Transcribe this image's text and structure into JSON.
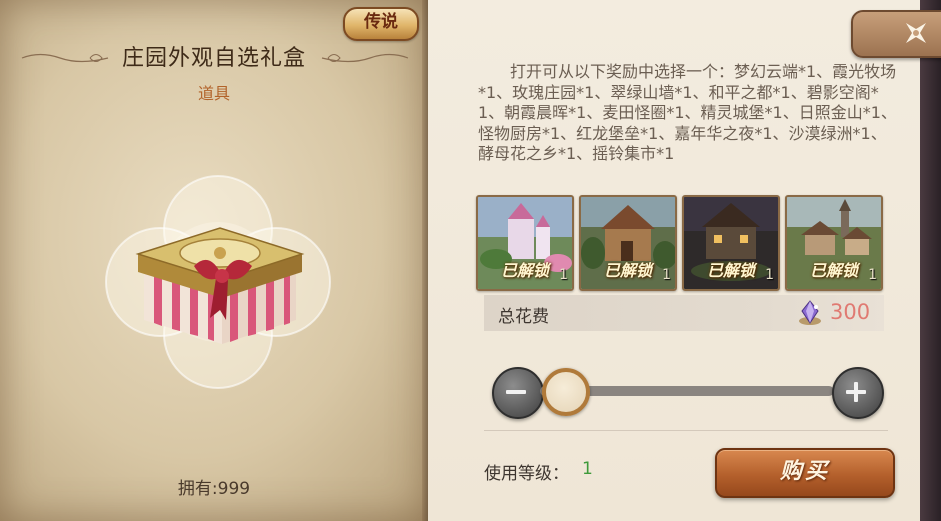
{
  "item": {
    "rarity": "传说",
    "title": "庄园外观自选礼盒",
    "type": "道具",
    "owned": "拥有:999"
  },
  "reward": {
    "description": "打开可从以下奖励中选择一个：梦幻云端*1、霞光牧场*1、玫瑰庄园*1、翠绿山墙*1、和平之都*1、碧影空阁*1、朝霞晨晖*1、麦田怪圈*1、精灵城堡*1、日照金山*1、怪物厨房*1、红龙堡垒*1、嘉年华之夜*1、沙漠绿洲*1、酵母花之乡*1、摇铃集市*1",
    "thumbnails": [
      {
        "label": "已解锁",
        "qty": "1",
        "icon": "pink-castle-scene"
      },
      {
        "label": "已解锁",
        "qty": "1",
        "icon": "wooden-house-scene"
      },
      {
        "label": "已解锁",
        "qty": "1",
        "icon": "night-manor-scene"
      },
      {
        "label": "已解锁",
        "qty": "1",
        "icon": "hillside-village-scene"
      }
    ]
  },
  "purchase": {
    "cost_label": "总花费",
    "cost_value": "300",
    "currency_icon": "crystal-currency-icon",
    "level_label": "使用等级：",
    "level_value": "1",
    "buy_label": "购买",
    "quantity_fraction": 0
  },
  "colors": {
    "accent_orange": "#b2632a",
    "cost_red": "#e07a72",
    "level_green": "#3e9a3a",
    "buy_button": "#b4602c"
  }
}
